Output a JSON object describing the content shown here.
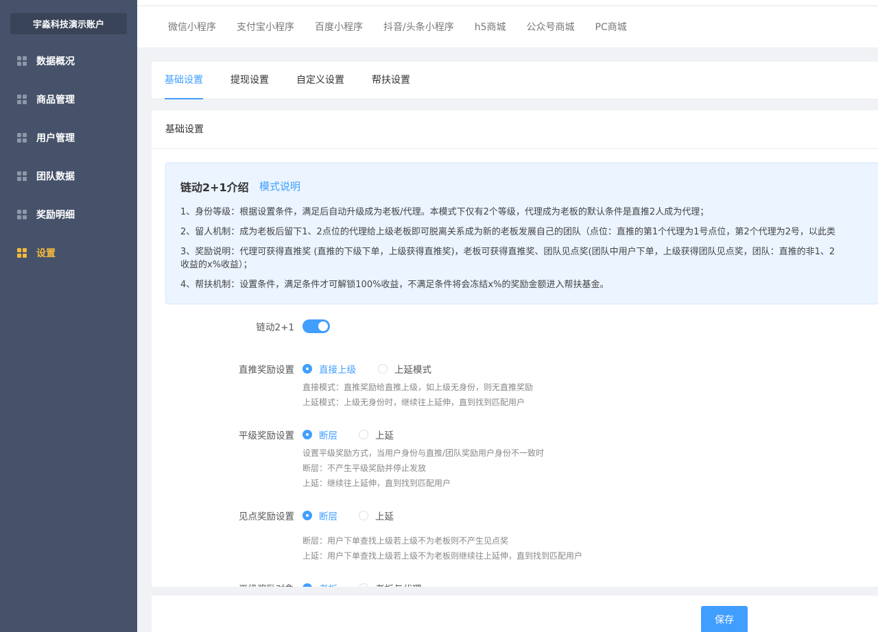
{
  "sidebar": {
    "account": "宇淼科技演示账户",
    "items": [
      {
        "label": "数据概况",
        "icon": "grid-icon",
        "active": false
      },
      {
        "label": "商品管理",
        "icon": "grid-icon",
        "active": false
      },
      {
        "label": "用户管理",
        "icon": "grid-icon",
        "active": false
      },
      {
        "label": "团队数据",
        "icon": "grid-icon",
        "active": false
      },
      {
        "label": "奖励明细",
        "icon": "grid-icon",
        "active": false
      },
      {
        "label": "设置",
        "icon": "grid-icon",
        "active": true
      }
    ],
    "bg_color": "#46526a",
    "active_color": "#f5b93b"
  },
  "platform_tabs": [
    "微信小程序",
    "支付宝小程序",
    "百度小程序",
    "抖音/头条小程序",
    "h5商城",
    "公众号商城",
    "PC商城"
  ],
  "settings_tabs": [
    {
      "label": "基础设置",
      "active": true
    },
    {
      "label": "提现设置",
      "active": false
    },
    {
      "label": "自定义设置",
      "active": false
    },
    {
      "label": "帮扶设置",
      "active": false
    }
  ],
  "card": {
    "header": "基础设置",
    "intro": {
      "title": "链动2+1介绍",
      "link": "模式说明",
      "lines": [
        "1、身份等级：根据设置条件，满足后自动升级成为老板/代理。本模式下仅有2个等级，代理成为老板的默认条件是直推2人成为代理；",
        "2、留人机制：成为老板后留下1、2点位的代理给上级老板即可脱离关系成为新的老板发展自己的团队（点位：直推的第1个代理为1号点位，第2个代理为2号，以此类",
        "3、奖励说明：代理可获得直推奖 (直推的下级下单，上级获得直推奖)，老板可获得直推奖、团队见点奖(团队中用户下单，上级获得团队见点奖，团队：直推的非1、2",
        "收益的x%收益）；",
        "4、帮扶机制：设置条件，满足条件才可解锁100%收益，不满足条件将会冻结x%的奖励金额进入帮扶基金。"
      ]
    },
    "switch": {
      "label": "链动2+1",
      "on": true
    },
    "direct_reward": {
      "label": "直推奖励设置",
      "options": [
        "直接上级",
        "上延模式"
      ],
      "selected": 0,
      "hints": [
        "直接模式：直推奖励给直推上级，如上级无身份，则无直推奖励",
        "上延模式：上级无身份时，继续往上延伸，直到找到匹配用户"
      ]
    },
    "level_reward": {
      "label": "平级奖励设置",
      "options": [
        "断层",
        "上延"
      ],
      "selected": 0,
      "hints": [
        "设置平级奖励方式，当用户身份与直推/团队奖励用户身份不一致时",
        "断层：不产生平级奖励并停止发放",
        "上延：继续往上延伸，直到找到匹配用户"
      ]
    },
    "point_reward": {
      "label": "见点奖励设置",
      "options": [
        "断层",
        "上延"
      ],
      "selected": 0,
      "hints": [
        "断层：用户下单查找上级若上级不为老板则不产生见点奖",
        "上延：用户下单查找上级若上级不为老板则继续往上延伸，直到找到匹配用户"
      ]
    },
    "level_target": {
      "label": "平级奖励对象",
      "options": [
        "老板",
        "老板与代理"
      ],
      "selected": 0
    }
  },
  "footer": {
    "save_label": "保存"
  },
  "accent_color": "#409eff"
}
